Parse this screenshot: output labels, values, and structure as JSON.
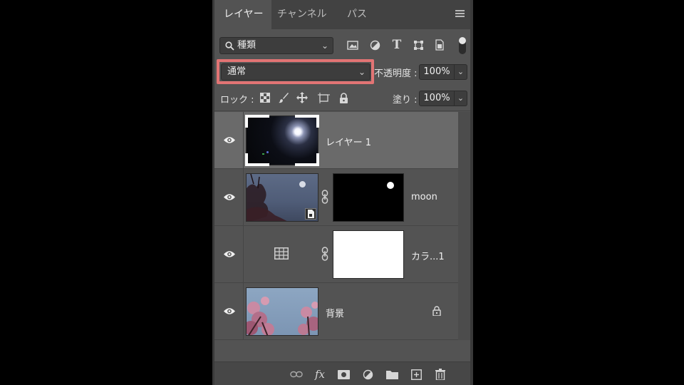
{
  "tabs": [
    {
      "label": "レイヤー",
      "active": true
    },
    {
      "label": "チャンネル",
      "active": false
    },
    {
      "label": "パス",
      "active": false
    }
  ],
  "filter": {
    "kind_label": "種類"
  },
  "blend": {
    "mode": "通常",
    "opacity_label": "不透明度 :",
    "opacity_value": "100%"
  },
  "lock": {
    "label": "ロック :",
    "fill_label": "塗り :",
    "fill_value": "100%"
  },
  "layers": [
    {
      "name": "レイヤー 1",
      "selected": true,
      "visible": true
    },
    {
      "name": "moon",
      "selected": false,
      "visible": true
    },
    {
      "name": "カラ...1",
      "selected": false,
      "visible": true
    },
    {
      "name": "背景",
      "selected": false,
      "visible": true,
      "locked": true
    }
  ],
  "colors": {
    "highlight": "#e27474",
    "panel": "#535353",
    "selected_row": "#6a6a6a"
  }
}
